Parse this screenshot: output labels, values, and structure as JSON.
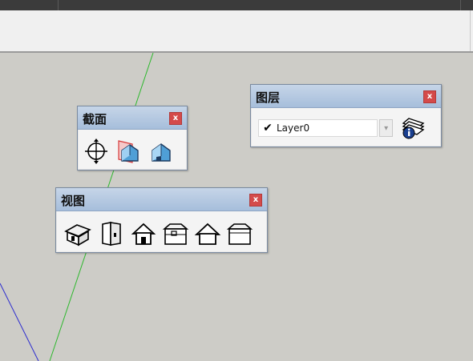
{
  "panels": {
    "section": {
      "title": "截面",
      "close_label": "x",
      "icons": [
        "section-plane-icon",
        "display-section-planes-icon",
        "display-section-cuts-icon"
      ]
    },
    "views": {
      "title": "视图",
      "close_label": "x",
      "icons": [
        "iso-view-icon",
        "top-view-icon",
        "front-view-icon",
        "right-view-icon",
        "back-view-icon",
        "left-view-icon"
      ]
    },
    "layers": {
      "title": "图层",
      "close_label": "x",
      "current_layer": "Layer0",
      "check_mark": "✔",
      "dropdown_glyph": "▾",
      "icon": "layer-manager-icon"
    }
  },
  "colors": {
    "canvas": "#cdccc7",
    "green_axis": "#2eb82e",
    "blue_axis": "#2c2ccf",
    "title_bar": "#a6bedb",
    "close_button": "#d44a4a"
  }
}
